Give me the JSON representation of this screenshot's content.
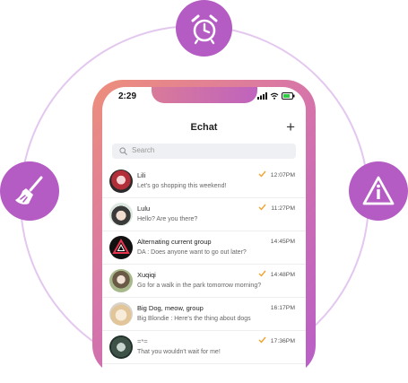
{
  "status": {
    "time": "2:29"
  },
  "header": {
    "title": "Echat",
    "add_icon": "+"
  },
  "search": {
    "placeholder": "Search"
  },
  "icons": {
    "top": "alarm-clock-icon",
    "left": "broom-icon",
    "right": "warning-icon"
  },
  "colors": {
    "accent": "#b45cc4",
    "ring": "#e3c7ef",
    "check": "#f0a32e"
  },
  "chats": [
    {
      "name": "Lili",
      "message": "Let's go shopping this weekend!",
      "time": "12:07PM",
      "read": true
    },
    {
      "name": "Lulu",
      "message": "Hello? Are you there?",
      "time": "11:27PM",
      "read": true
    },
    {
      "name": "Alternating current group",
      "message": "DA : Does anyone want to go out later?",
      "time": "14:45PM",
      "read": false
    },
    {
      "name": "Xuqiqi",
      "message": "Go for a walk in the park tomorrow morning?",
      "time": "14:48PM",
      "read": true
    },
    {
      "name": "Big Dog, meow, group",
      "message": "Big Blondie : Here's the thing about dogs",
      "time": "16:17PM",
      "read": false
    },
    {
      "name": "=*=",
      "message": "That you wouldn't wait for me!",
      "time": "17:36PM",
      "read": true
    }
  ]
}
